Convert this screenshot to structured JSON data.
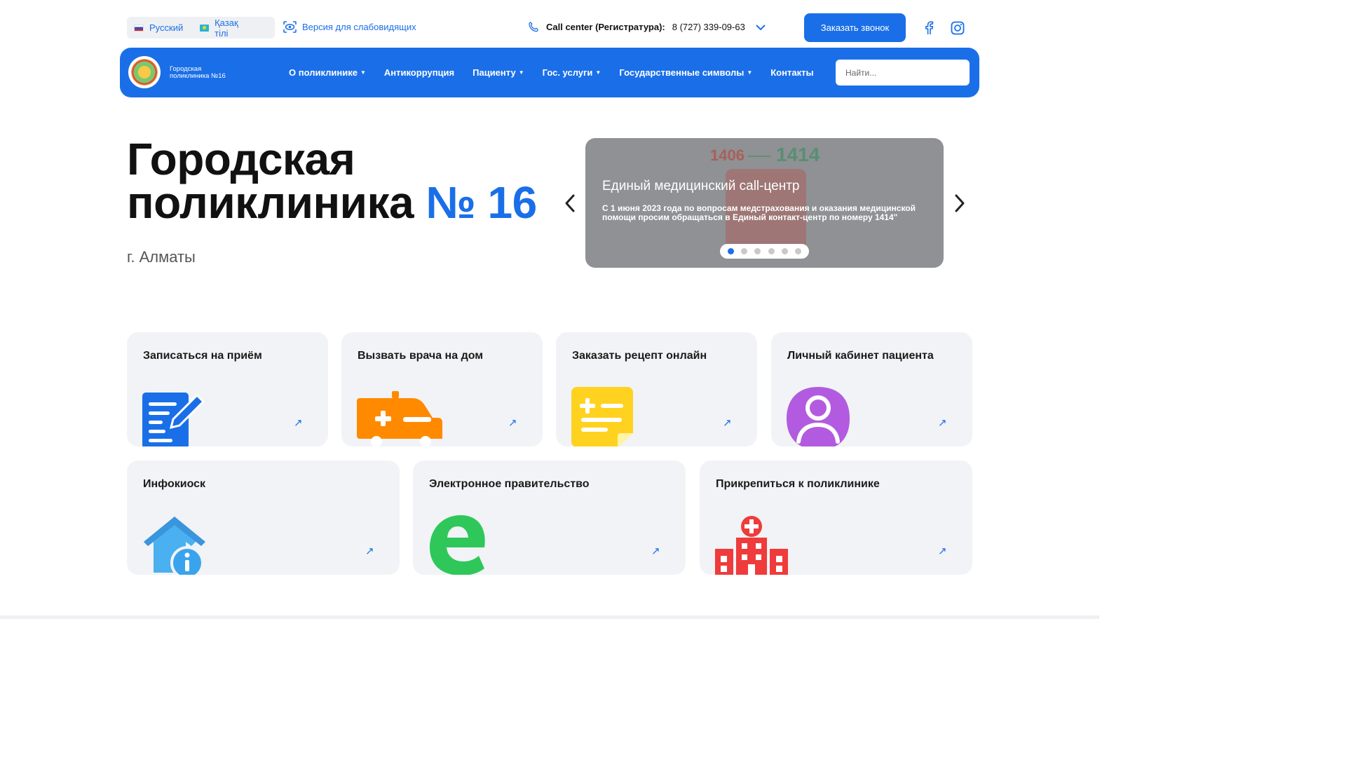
{
  "topbar": {
    "languages": [
      {
        "label": "Русский",
        "flag": "ru-flag-icon"
      },
      {
        "label": "Қазақ тілі",
        "flag": "kz-flag-icon"
      }
    ],
    "vision_label": "Версия для слабовидящих",
    "callcenter_label": "Call center (Регистратура):",
    "callcenter_phone": "8 (727) 339-09-63",
    "order_call_label": "Заказать звонок",
    "social": [
      "facebook-icon",
      "instagram-icon"
    ]
  },
  "nav": {
    "brand_line1": "Городская",
    "brand_line2": "поликлиника №16",
    "items": [
      {
        "label": "О поликлинике",
        "dropdown": true
      },
      {
        "label": "Антикоррупция",
        "dropdown": false
      },
      {
        "label": "Пациенту",
        "dropdown": true
      },
      {
        "label": "Гос. услуги",
        "dropdown": true
      },
      {
        "label": "Государственные символы",
        "dropdown": true
      },
      {
        "label": "Контакты",
        "dropdown": false
      }
    ],
    "search_placeholder": "Найти..."
  },
  "hero": {
    "title_line1": "Городская",
    "title_line2": "поликлиника",
    "title_accent": "№ 16",
    "city": "г. Алматы"
  },
  "slider": {
    "bg_text_from": "1406",
    "bg_text_to": "1414",
    "title": "Единый медицинский call-центр",
    "text": "С 1 июня 2023 года по вопросам медстрахования и оказания медицинской помощи просим обращаться в Единый контакт-центр по номеру 1414\"",
    "slide_count": 6,
    "active_index": 0
  },
  "services_row1": [
    {
      "title": "Записаться на приём",
      "icon": "appointment-form-icon"
    },
    {
      "title": "Вызвать врача на дом",
      "icon": "ambulance-icon"
    },
    {
      "title": "Заказать рецепт онлайн",
      "icon": "prescription-note-icon"
    },
    {
      "title": "Личный кабинет пациента",
      "icon": "user-profile-icon"
    }
  ],
  "services_row2": [
    {
      "title": "Инфокиоск",
      "icon": "info-house-icon"
    },
    {
      "title": "Электронное правительство",
      "icon": "egov-e-icon"
    },
    {
      "title": "Прикрепиться к поликлинике",
      "icon": "hospital-building-icon"
    }
  ],
  "colors": {
    "accent": "#1a6fe8",
    "card_bg": "#f1f3f6",
    "ambulance": "#ff8a00",
    "note": "#ffd21f",
    "profile": "#b25be0",
    "info_house": "#4ab0f0",
    "egov": "#2fc75a",
    "hospital": "#ef3b3b"
  }
}
